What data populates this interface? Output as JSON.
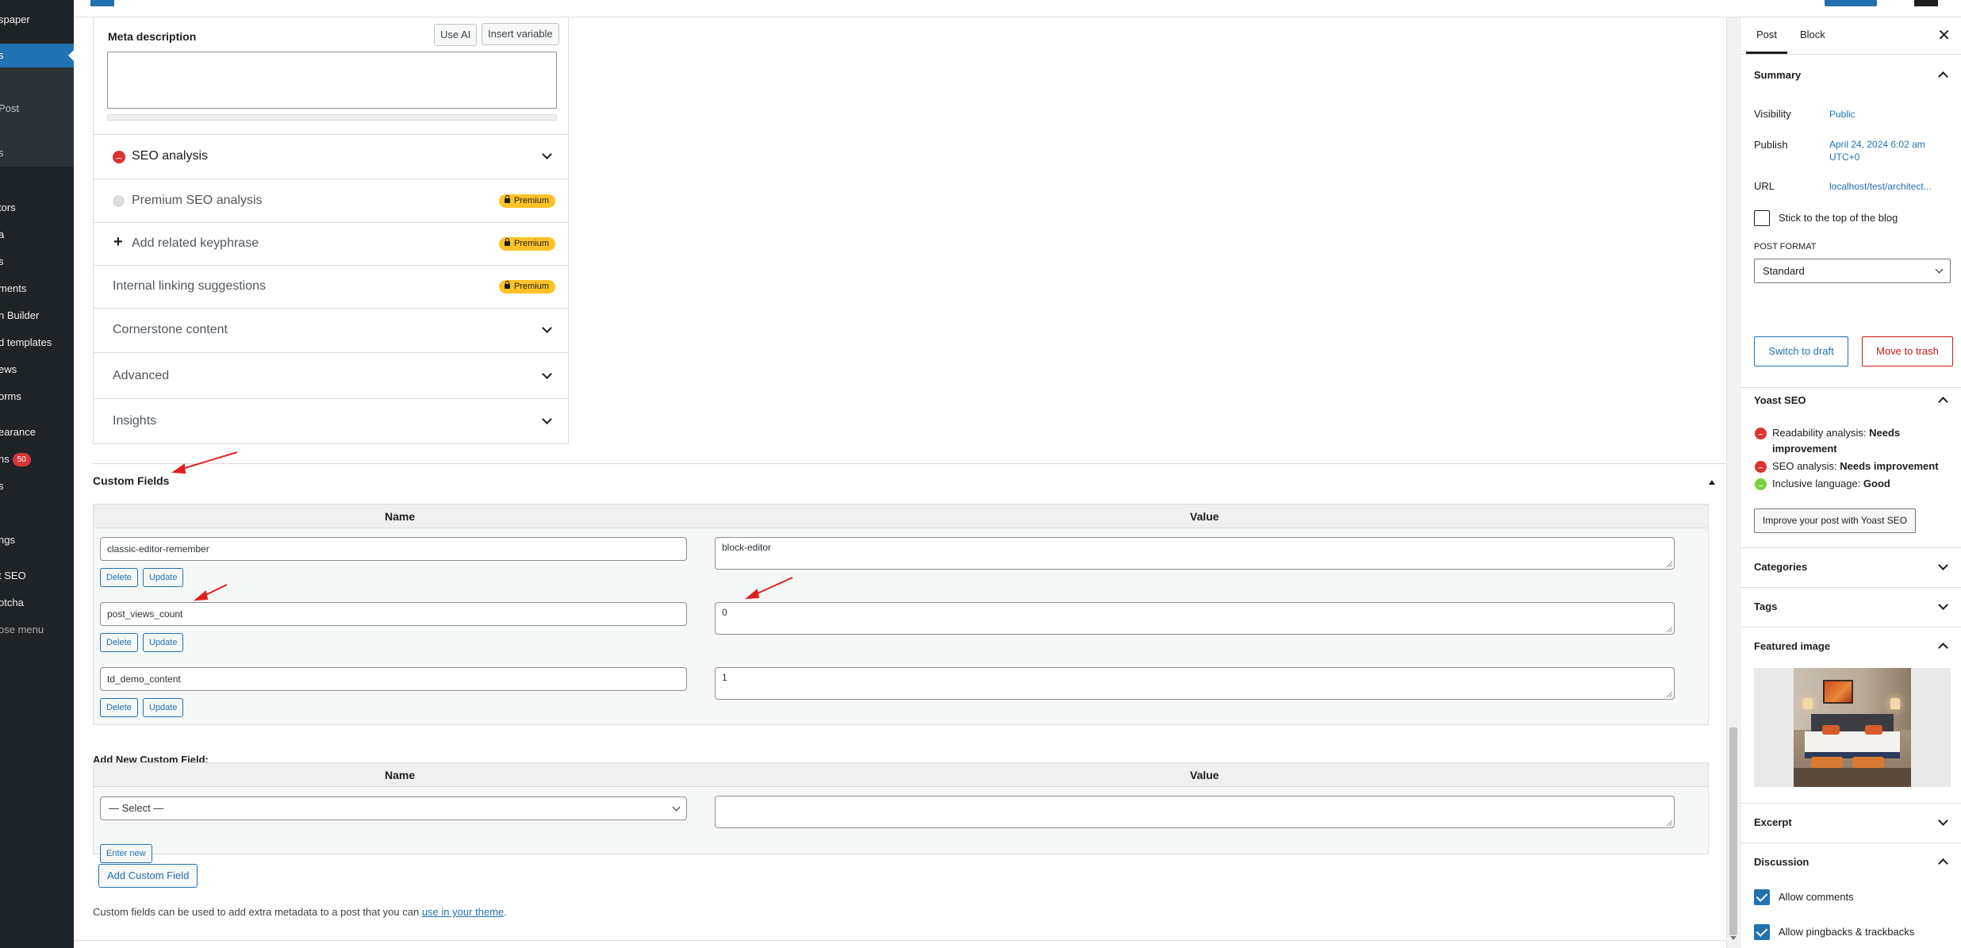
{
  "admin_menu": {
    "items": [
      {
        "label": "spaper",
        "state": "normal"
      },
      {
        "label": "s",
        "state": "current"
      },
      {
        "label": "Post",
        "state": "sub"
      },
      {
        "label": "s",
        "state": "sub"
      },
      {
        "label": "tors",
        "state": "normal"
      },
      {
        "label": "a",
        "state": "normal"
      },
      {
        "label": "s",
        "state": "normal"
      },
      {
        "label": "ments",
        "state": "normal"
      },
      {
        "label": "n Builder",
        "state": "normal"
      },
      {
        "label": "d templates",
        "state": "normal"
      },
      {
        "label": "ews",
        "state": "normal"
      },
      {
        "label": "orms",
        "state": "normal"
      },
      {
        "label": "earance",
        "state": "normal"
      },
      {
        "label": "ns",
        "state": "normal",
        "badge": "50"
      },
      {
        "label": "s",
        "state": "normal"
      },
      {
        "label": "",
        "state": "normal"
      },
      {
        "label": "ngs",
        "state": "normal"
      },
      {
        "label": "t SEO",
        "state": "normal"
      },
      {
        "label": "otcha",
        "state": "normal"
      },
      {
        "label": "ose menu",
        "state": "muted"
      }
    ]
  },
  "yoast_metabox": {
    "meta_description_label": "Meta description",
    "use_ai_label": "Use AI",
    "insert_variable_label": "Insert variable",
    "rows": [
      {
        "label": "SEO analysis",
        "icon": "sad-face-red-icon",
        "expand": true
      },
      {
        "label": "Premium SEO analysis",
        "icon": "grey-dot-icon",
        "premium": "Premium"
      },
      {
        "label": "Add related keyphrase",
        "icon": "plus-icon",
        "premium": "Premium"
      },
      {
        "label": "Internal linking suggestions",
        "premium": "Premium"
      },
      {
        "label": "Cornerstone content",
        "expand": true
      },
      {
        "label": "Advanced",
        "expand": true
      },
      {
        "label": "Insights",
        "expand": true
      }
    ]
  },
  "custom_fields": {
    "title": "Custom Fields",
    "name_header": "Name",
    "value_header": "Value",
    "delete_label": "Delete",
    "update_label": "Update",
    "fields": [
      {
        "name": "classic-editor-remember",
        "value": "block-editor"
      },
      {
        "name": "post_views_count",
        "value": "0"
      },
      {
        "name": "td_demo_content",
        "value": "1"
      }
    ],
    "add_new_title": "Add New Custom Field:",
    "select_value": "— Select —",
    "enter_new_label": "Enter new",
    "add_button_label": "Add Custom Field",
    "note_text": "Custom fields can be used to add extra metadata to a post that you can ",
    "note_link": "use in your theme",
    "note_end": "."
  },
  "settings_sidebar": {
    "tab_post": "Post",
    "tab_block": "Block",
    "close_symbol": "✕",
    "summary_title": "Summary",
    "visibility_label": "Visibility",
    "visibility_value": "Public",
    "publish_label": "Publish",
    "publish_value": "April 24, 2024 6:02 am UTC+0",
    "url_label": "URL",
    "url_value": "localhost/test/architect...",
    "stick_label": "Stick to the top of the blog",
    "post_format_label": "POST FORMAT",
    "post_format_value": "Standard",
    "switch_draft_label": "Switch to draft",
    "move_trash_label": "Move to trash",
    "yoast_title": "Yoast SEO",
    "readability_prefix": "Readability analysis: ",
    "readability_value": "Needs improvement",
    "seo_prefix": "SEO analysis: ",
    "seo_value": "Needs improvement",
    "inclusive_prefix": "Inclusive language: ",
    "inclusive_value": "Good",
    "improve_label": "Improve your post with Yoast SEO",
    "categories_title": "Categories",
    "tags_title": "Tags",
    "featured_title": "Featured image",
    "excerpt_title": "Excerpt",
    "discussion_title": "Discussion",
    "allow_comments_label": "Allow comments",
    "allow_pingbacks_label": "Allow pingbacks & trackbacks"
  },
  "colors": {
    "wp_blue": "#2271b1",
    "admin_dark": "#1d2327",
    "premium_yellow": "#fec228",
    "error_red": "#dc3232",
    "good_green": "#7ad03a",
    "trash_red": "#cc1818",
    "annotation_red": "#e02020"
  }
}
